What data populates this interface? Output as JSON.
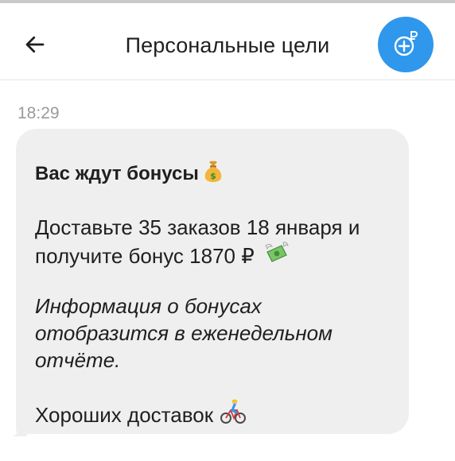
{
  "header": {
    "title": "Персональные цели",
    "back_icon": "arrow-left-icon",
    "bonus_icon": "plus-ruble-icon",
    "bonus_button_color": "#2f97ec"
  },
  "chat": {
    "timestamp": "18:29",
    "message": {
      "title": "Вас ждут бонусы",
      "title_emoji": "money-bag-icon",
      "body_line1": "Доставьте 35 заказов 18 января и",
      "body_line2": "получите бонус 1870 ₽",
      "body_emoji": "money-with-wings-icon",
      "note_line1": "Информация о бонусах",
      "note_line2": "отобразится в еженедельном",
      "note_line3": "отчёте.",
      "footer": "Хороших доставок",
      "footer_emoji": "bicyclist-icon"
    },
    "bubble_color": "#efefef"
  }
}
